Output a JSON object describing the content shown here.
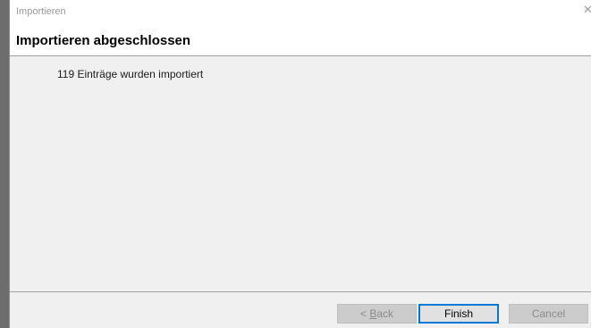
{
  "window": {
    "title": "Importieren",
    "close_glyph": "✕"
  },
  "header": {
    "heading": "Importieren abgeschlossen"
  },
  "content": {
    "message": "119 Einträge wurden importiert"
  },
  "buttons": {
    "back_prefix": "< ",
    "back_mnemonic": "B",
    "back_rest": "ack",
    "finish": "Finish",
    "cancel": "Cancel"
  }
}
